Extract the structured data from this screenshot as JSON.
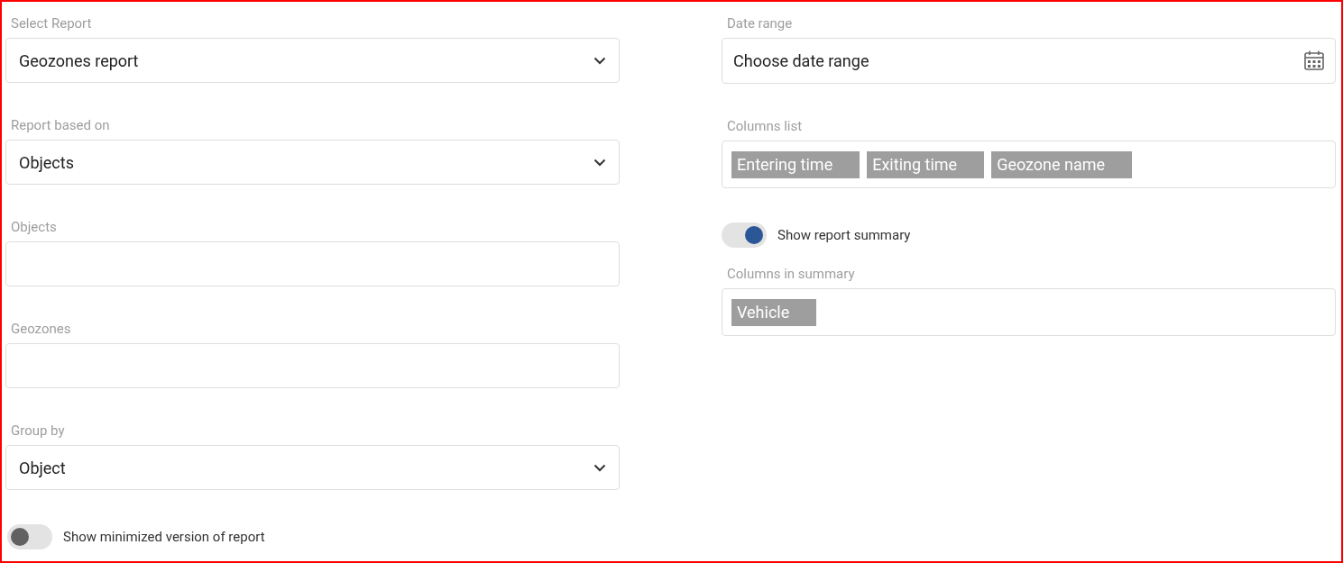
{
  "left_fields": [
    {
      "kind": "select",
      "label": "Select Report",
      "value": "Geozones report"
    },
    {
      "kind": "select",
      "label": "Report based on",
      "value": "Objects"
    },
    {
      "kind": "input",
      "label": "Objects"
    },
    {
      "kind": "input",
      "label": "Geozones"
    },
    {
      "kind": "select",
      "label": "Group by",
      "value": "Object"
    }
  ],
  "minimized_toggle": {
    "label": "Show minimized version of report",
    "on": false
  },
  "date_range": {
    "label": "Date range",
    "placeholder": "Choose date range"
  },
  "columns_list": {
    "label": "Columns list",
    "chips": [
      "Entering time",
      "Exiting time",
      "Geozone name"
    ]
  },
  "summary_toggle": {
    "label": "Show report summary",
    "on": true
  },
  "columns_in_summary": {
    "label": "Columns in summary",
    "chips": [
      "Vehicle"
    ]
  }
}
